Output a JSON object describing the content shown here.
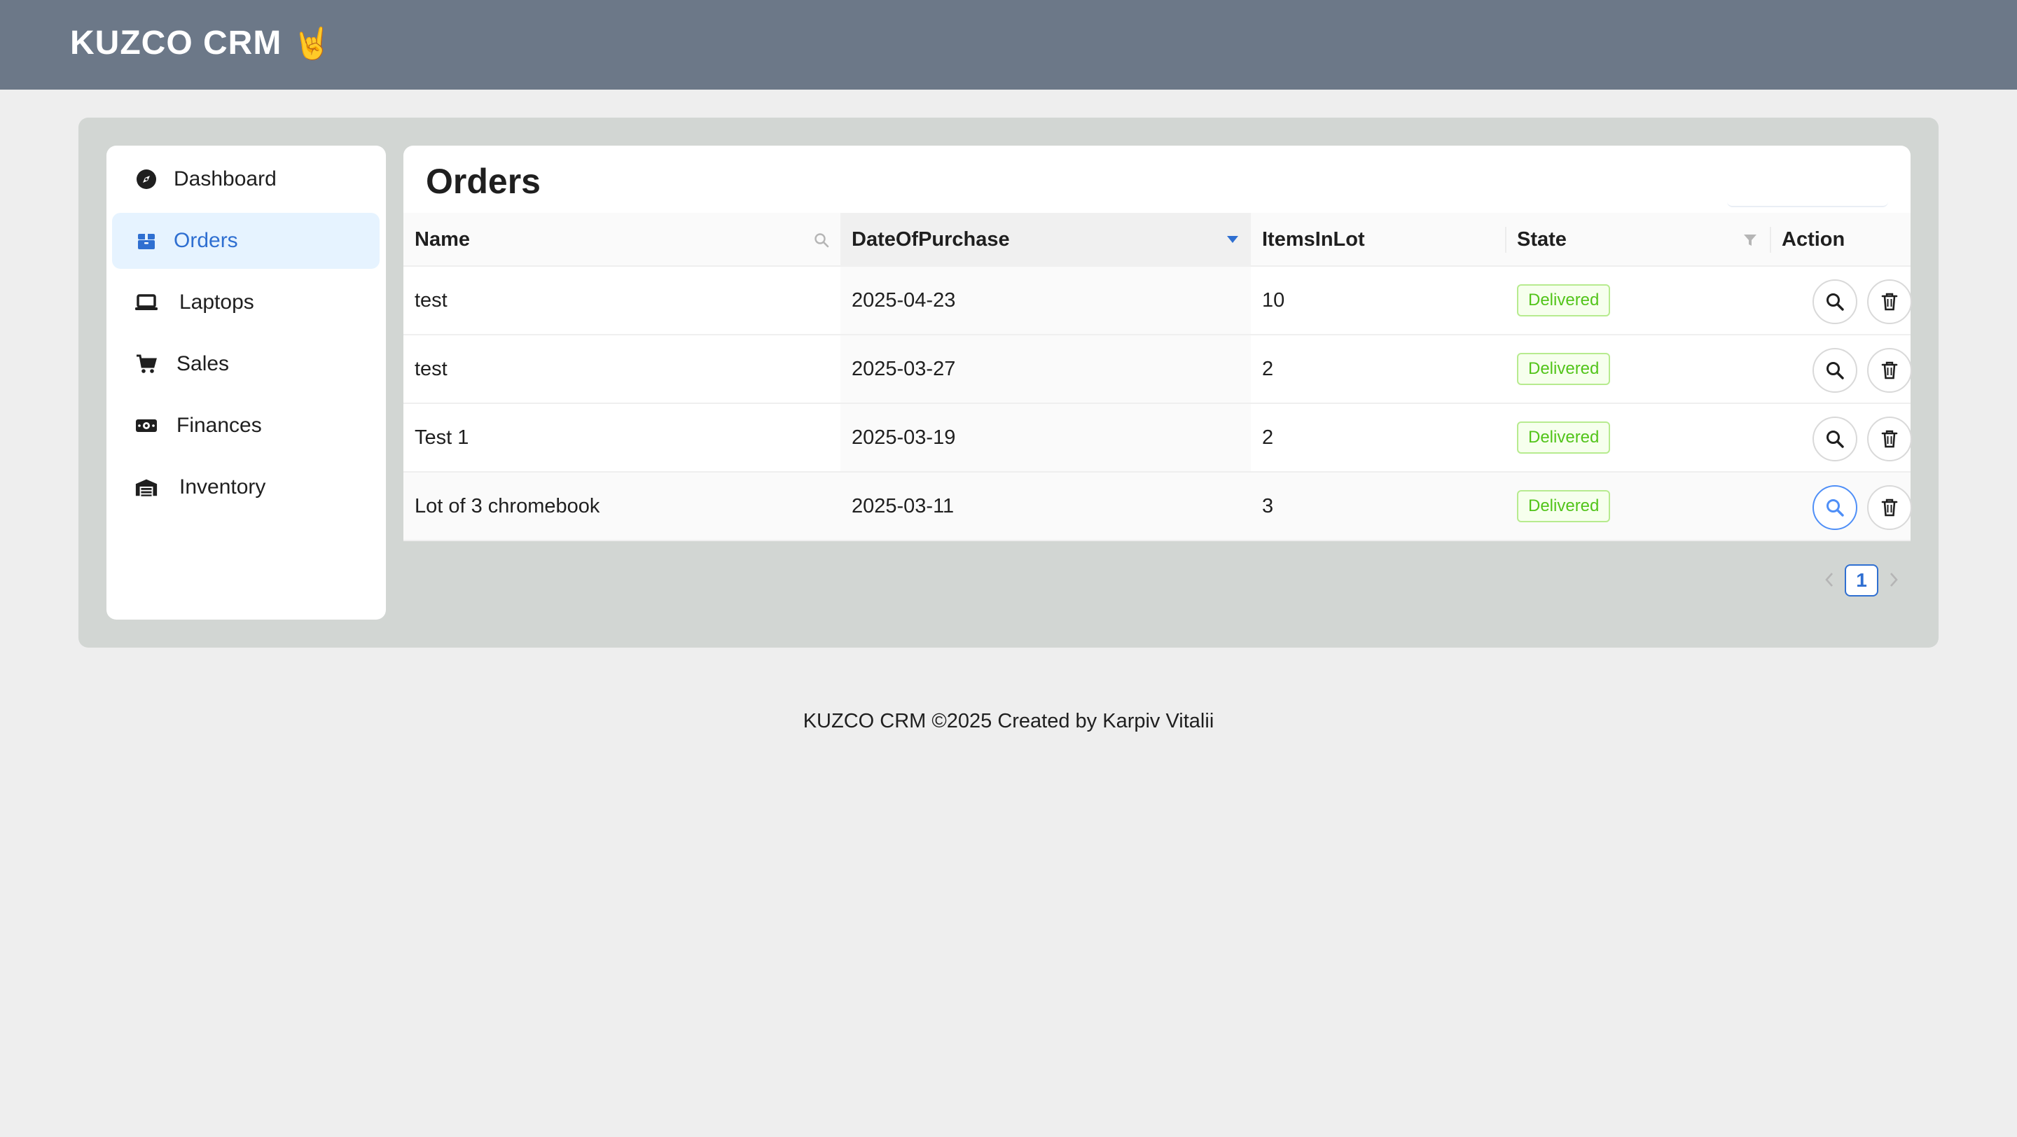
{
  "app": {
    "title": "KUZCO CRM",
    "emoji": "🤘"
  },
  "sidebar": {
    "items": [
      {
        "label": "Dashboard",
        "icon": "compass-icon",
        "active": false
      },
      {
        "label": "Orders",
        "icon": "box-icon",
        "active": true
      },
      {
        "label": "Laptops",
        "icon": "laptop-icon",
        "active": false
      },
      {
        "label": "Sales",
        "icon": "cart-icon",
        "active": false
      },
      {
        "label": "Finances",
        "icon": "money-icon",
        "active": false
      },
      {
        "label": "Inventory",
        "icon": "warehouse-icon",
        "active": false
      }
    ]
  },
  "main": {
    "title": "Orders",
    "table": {
      "columns": [
        "Name",
        "DateOfPurchase",
        "ItemsInLot",
        "State",
        "Action"
      ],
      "sorted_column": "DateOfPurchase",
      "sort_direction": "descending",
      "rows": [
        {
          "name": "test",
          "date": "2025-04-23",
          "items": "10",
          "state": "Delivered"
        },
        {
          "name": "test",
          "date": "2025-03-27",
          "items": "2",
          "state": "Delivered"
        },
        {
          "name": "Test 1",
          "date": "2025-03-19",
          "items": "2",
          "state": "Delivered"
        },
        {
          "name": "Lot of 3 chromebook",
          "date": "2025-03-11",
          "items": "3",
          "state": "Delivered"
        }
      ]
    },
    "pagination": {
      "current": "1"
    }
  },
  "footer": {
    "text": "KUZCO CRM ©2025 Created by Karpiv Vitalii"
  },
  "colors": {
    "header_bg": "#6c7888",
    "accent": "#2f6fd1",
    "status_delivered": "#52c41a",
    "container_bg": "#d2d6d3"
  }
}
